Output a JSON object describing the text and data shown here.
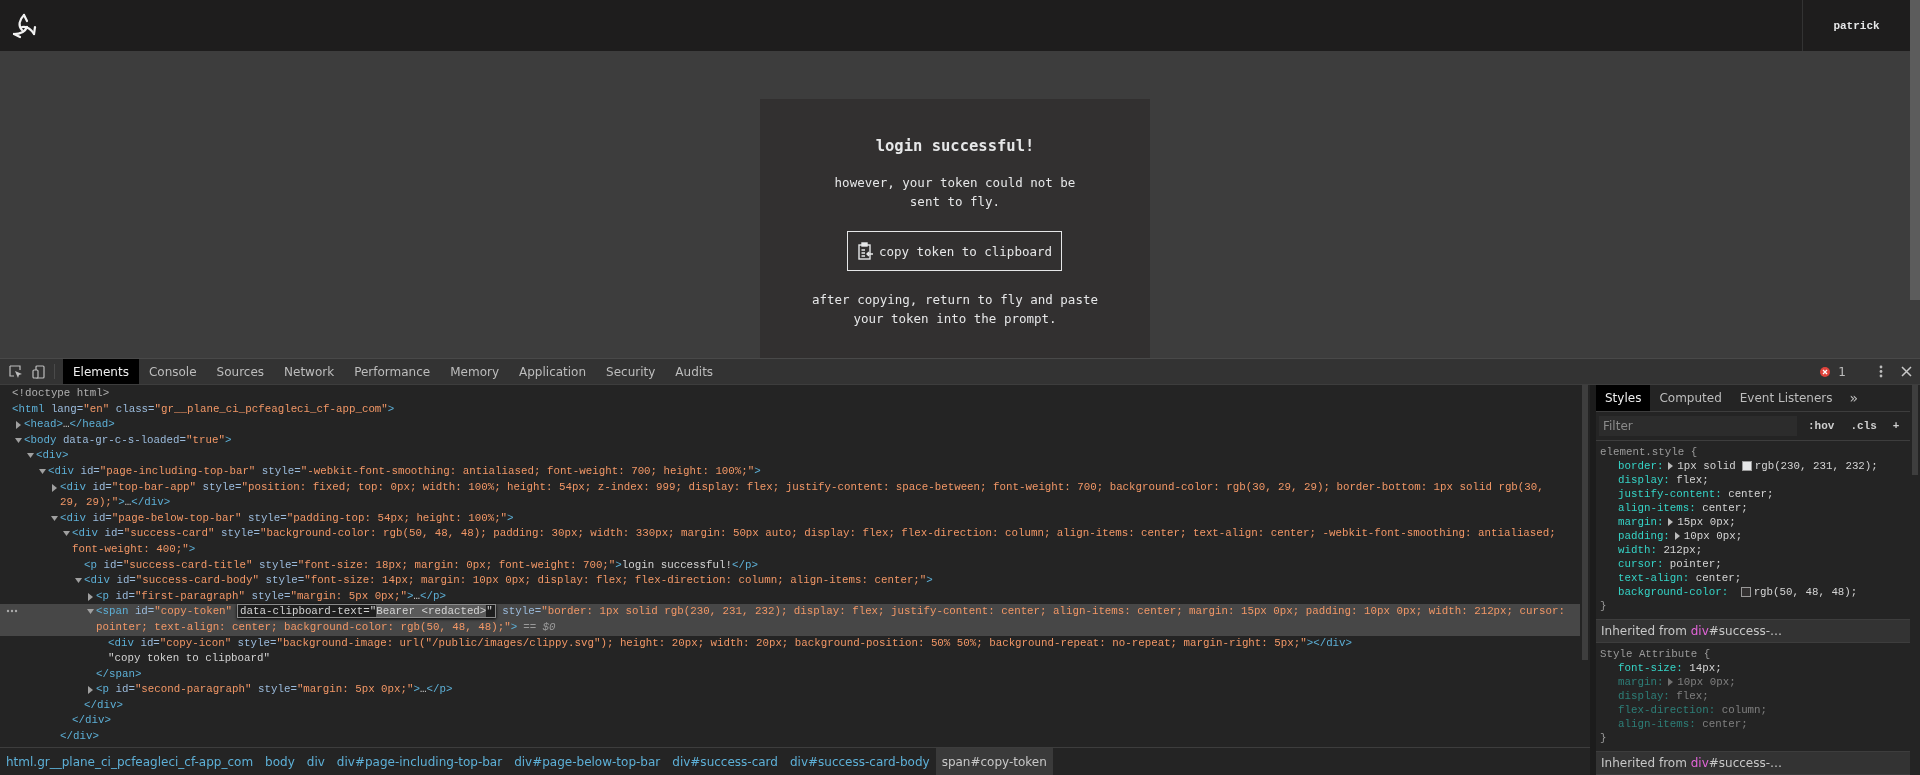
{
  "top_bar": {
    "user": "patrick"
  },
  "card": {
    "title": "login successful!",
    "first_paragraph": "however, your token could not be\nsent to fly.",
    "button": "copy token to clipboard",
    "second_paragraph": "after copying, return to fly and paste\nyour token into the prompt."
  },
  "devtools": {
    "tabs": [
      {
        "label": "Elements",
        "selected": true
      },
      {
        "label": "Console",
        "selected": false
      },
      {
        "label": "Sources",
        "selected": false
      },
      {
        "label": "Network",
        "selected": false
      },
      {
        "label": "Performance",
        "selected": false
      },
      {
        "label": "Memory",
        "selected": false
      },
      {
        "label": "Application",
        "selected": false
      },
      {
        "label": "Security",
        "selected": false
      },
      {
        "label": "Audits",
        "selected": false
      }
    ],
    "errors": "1"
  },
  "tree": [
    {
      "selected": false,
      "parts": [
        {
          "kind": "doctype",
          "text": "<!doctype html>"
        }
      ]
    },
    {
      "selected": false,
      "parts": [
        {
          "kind": "tag",
          "text": "<html"
        },
        {
          "kind": "attr",
          "text": " lang="
        },
        {
          "kind": "value",
          "text": "\"en\""
        },
        {
          "kind": "attr",
          "text": " class="
        },
        {
          "kind": "value",
          "text": "\"gr__plane_ci_pcfeagleci_cf-app_com\""
        },
        {
          "kind": "tag",
          "text": ">"
        }
      ],
      "children": [
        {
          "selected": false,
          "expanded": false,
          "parts": [
            {
              "kind": "tag",
              "text": "<head>"
            },
            {
              "kind": "text",
              "text": "…"
            },
            {
              "kind": "tag",
              "text": "</head>"
            }
          ]
        },
        {
          "selected": false,
          "expanded": true,
          "parts": [
            {
              "kind": "tag",
              "text": "<body"
            },
            {
              "kind": "attr",
              "text": " data-gr-c-s-loaded="
            },
            {
              "kind": "value",
              "text": "\"true\""
            },
            {
              "kind": "tag",
              "text": ">"
            }
          ],
          "children": [
            {
              "selected": false,
              "expanded": true,
              "parts": [
                {
                  "kind": "tag",
                  "text": "<div>"
                }
              ],
              "children": [
                {
                  "selected": false,
                  "expanded": true,
                  "parts": [
                    {
                      "kind": "tag",
                      "text": "<div"
                    },
                    {
                      "kind": "attr",
                      "text": " id="
                    },
                    {
                      "kind": "value",
                      "text": "\"page-including-top-bar\""
                    },
                    {
                      "kind": "attr",
                      "text": " style="
                    },
                    {
                      "kind": "value",
                      "text": "\"-webkit-font-smoothing: antialiased; font-weight: 700; height: 100%;\""
                    },
                    {
                      "kind": "tag",
                      "text": ">"
                    }
                  ],
                  "children": [
                    {
                      "selected": false,
                      "expanded": false,
                      "parts": [
                        {
                          "kind": "tag",
                          "text": "<div"
                        },
                        {
                          "kind": "attr",
                          "text": " id="
                        },
                        {
                          "kind": "value",
                          "text": "\"top-bar-app\""
                        },
                        {
                          "kind": "attr",
                          "text": " style="
                        },
                        {
                          "kind": "value",
                          "text": "\"position: fixed; top: 0px; width: 100%; height: 54px; z-index: 999; display: flex; justify-content: space-between; font-weight: 700; background-color: rgb(30, 29, 29); border-bottom: 1px solid rgb(30, 29, 29);\""
                        },
                        {
                          "kind": "tag",
                          "text": ">"
                        },
                        {
                          "kind": "text",
                          "text": "…"
                        },
                        {
                          "kind": "tag",
                          "text": "</div>"
                        }
                      ]
                    },
                    {
                      "selected": false,
                      "expanded": true,
                      "parts": [
                        {
                          "kind": "tag",
                          "text": "<div"
                        },
                        {
                          "kind": "attr",
                          "text": " id="
                        },
                        {
                          "kind": "value",
                          "text": "\"page-below-top-bar\""
                        },
                        {
                          "kind": "attr",
                          "text": " style="
                        },
                        {
                          "kind": "value",
                          "text": "\"padding-top: 54px; height: 100%;\""
                        },
                        {
                          "kind": "tag",
                          "text": ">"
                        }
                      ],
                      "children": [
                        {
                          "selected": false,
                          "expanded": true,
                          "parts": [
                            {
                              "kind": "tag",
                              "text": "<div"
                            },
                            {
                              "kind": "attr",
                              "text": " id="
                            },
                            {
                              "kind": "value",
                              "text": "\"success-card\""
                            },
                            {
                              "kind": "attr",
                              "text": " style="
                            },
                            {
                              "kind": "value",
                              "text": "\"background-color: rgb(50, 48, 48); padding: 30px; width: 330px; margin: 50px auto; display: flex; flex-direction: column; align-items: center; text-align: center; -webkit-font-smoothing: antialiased; font-weight: 400;\""
                            },
                            {
                              "kind": "tag",
                              "text": ">"
                            }
                          ],
                          "children": [
                            {
                              "selected": false,
                              "parts": [
                                {
                                  "kind": "tag",
                                  "text": "<p"
                                },
                                {
                                  "kind": "attr",
                                  "text": " id="
                                },
                                {
                                  "kind": "value",
                                  "text": "\"success-card-title\""
                                },
                                {
                                  "kind": "attr",
                                  "text": " style="
                                },
                                {
                                  "kind": "value",
                                  "text": "\"font-size: 18px; margin: 0px; font-weight: 700;\""
                                },
                                {
                                  "kind": "tag",
                                  "text": ">"
                                },
                                {
                                  "kind": "text",
                                  "text": "login successful!"
                                },
                                {
                                  "kind": "tag",
                                  "text": "</p>"
                                }
                              ]
                            },
                            {
                              "selected": false,
                              "expanded": true,
                              "parts": [
                                {
                                  "kind": "tag",
                                  "text": "<div"
                                },
                                {
                                  "kind": "attr",
                                  "text": " id="
                                },
                                {
                                  "kind": "value",
                                  "text": "\"success-card-body\""
                                },
                                {
                                  "kind": "attr",
                                  "text": " style="
                                },
                                {
                                  "kind": "value",
                                  "text": "\"font-size: 14px; margin: 10px 0px; display: flex; flex-direction: column; align-items: center;\""
                                },
                                {
                                  "kind": "tag",
                                  "text": ">"
                                }
                              ],
                              "children": [
                                {
                                  "selected": false,
                                  "expanded": false,
                                  "parts": [
                                    {
                                      "kind": "tag",
                                      "text": "<p"
                                    },
                                    {
                                      "kind": "attr",
                                      "text": " id="
                                    },
                                    {
                                      "kind": "value",
                                      "text": "\"first-paragraph\""
                                    },
                                    {
                                      "kind": "attr",
                                      "text": " style="
                                    },
                                    {
                                      "kind": "value",
                                      "text": "\"margin: 5px 0px;\""
                                    },
                                    {
                                      "kind": "tag",
                                      "text": ">"
                                    },
                                    {
                                      "kind": "text",
                                      "text": "…"
                                    },
                                    {
                                      "kind": "tag",
                                      "text": "</p>"
                                    }
                                  ]
                                },
                                {
                                  "selected": true,
                                  "expanded": true,
                                  "parts": [
                                    {
                                      "kind": "tag",
                                      "text": "<span"
                                    },
                                    {
                                      "kind": "attr",
                                      "text": " id="
                                    },
                                    {
                                      "kind": "value",
                                      "text": "\"copy-token\""
                                    },
                                    {
                                      "kind": "edit",
                                      "name": "data-clipboard-text=\"",
                                      "selection": "Bearer <redacted>",
                                      "end": "\""
                                    },
                                    {
                                      "kind": "attr",
                                      "text": " style="
                                    },
                                    {
                                      "kind": "value",
                                      "text": "\"border: 1px solid rgb(230, 231, 232); display: flex; justify-content: center; align-items: center; margin: 15px 0px; padding: 10px 0px; width: 212px; cursor: pointer; text-align: center; background-color: rgb(50, 48, 48);\""
                                    },
                                    {
                                      "kind": "tag",
                                      "text": ">"
                                    },
                                    {
                                      "kind": "marker",
                                      "text": "== $0"
                                    }
                                  ],
                                  "children": [
                                    {
                                      "selected": false,
                                      "parts": [
                                        {
                                          "kind": "tag",
                                          "text": "<div"
                                        },
                                        {
                                          "kind": "attr",
                                          "text": " id="
                                        },
                                        {
                                          "kind": "value",
                                          "text": "\"copy-icon\""
                                        },
                                        {
                                          "kind": "attr",
                                          "text": " style="
                                        },
                                        {
                                          "kind": "value",
                                          "text": "\"background-image: url(\"/public/images/clippy.svg\"); height: 20px; width: 20px; background-position: 50% 50%; background-repeat: no-repeat; margin-right: 5px;\""
                                        },
                                        {
                                          "kind": "tag",
                                          "text": "></div>"
                                        }
                                      ]
                                    },
                                    {
                                      "selected": false,
                                      "parts": [
                                        {
                                          "kind": "text",
                                          "text": "\"copy token to clipboard\""
                                        }
                                      ]
                                    }
                                  ],
                                  "close": [
                                    {
                                      "kind": "tag",
                                      "text": "</span>"
                                    }
                                  ]
                                },
                                {
                                  "selected": false,
                                  "expanded": false,
                                  "parts": [
                                    {
                                      "kind": "tag",
                                      "text": "<p"
                                    },
                                    {
                                      "kind": "attr",
                                      "text": " id="
                                    },
                                    {
                                      "kind": "value",
                                      "text": "\"second-paragraph\""
                                    },
                                    {
                                      "kind": "attr",
                                      "text": " style="
                                    },
                                    {
                                      "kind": "value",
                                      "text": "\"margin: 5px 0px;\""
                                    },
                                    {
                                      "kind": "tag",
                                      "text": ">"
                                    },
                                    {
                                      "kind": "text",
                                      "text": "…"
                                    },
                                    {
                                      "kind": "tag",
                                      "text": "</p>"
                                    }
                                  ]
                                }
                              ],
                              "close": [
                                {
                                  "kind": "tag",
                                  "text": "</div>"
                                }
                              ]
                            }
                          ],
                          "close": [
                            {
                              "kind": "tag",
                              "text": "</div>"
                            }
                          ]
                        }
                      ],
                      "close": [
                        {
                          "kind": "tag",
                          "text": "</div>"
                        }
                      ]
                    }
                  ]
                }
              ]
            }
          ]
        }
      ]
    }
  ],
  "breadcrumbs": [
    {
      "label": "html.gr__plane_ci_pcfeagleci_cf-app_com",
      "selected": false
    },
    {
      "label": "body",
      "selected": false
    },
    {
      "label": "div",
      "selected": false
    },
    {
      "label": "div#page-including-top-bar",
      "selected": false
    },
    {
      "label": "div#page-below-top-bar",
      "selected": false
    },
    {
      "label": "div#success-card",
      "selected": false
    },
    {
      "label": "div#success-card-body",
      "selected": false
    },
    {
      "label": "span#copy-token",
      "selected": true
    }
  ],
  "styles": {
    "tabs": [
      {
        "label": "Styles",
        "selected": true
      },
      {
        "label": "Computed",
        "selected": false
      },
      {
        "label": "Event Listeners",
        "selected": false
      }
    ],
    "more": "»",
    "filter": {
      "placeholder": "Filter"
    },
    "buttons": [
      ":hov",
      ".cls",
      "+"
    ],
    "sections": [
      {
        "kind": "rule",
        "selector": "element.style {",
        "declarations": [
          {
            "property": "border:",
            "expandable": true,
            "inactive": false,
            "value": "1px solid",
            "color": "#e6e7e8",
            "after": "rgb(230, 231, 232);"
          },
          {
            "property": "display:",
            "expandable": false,
            "inactive": false,
            "value": "flex;"
          },
          {
            "property": "justify-content:",
            "expandable": false,
            "inactive": false,
            "value": "center;"
          },
          {
            "property": "align-items:",
            "expandable": false,
            "inactive": false,
            "value": "center;"
          },
          {
            "property": "margin:",
            "expandable": true,
            "inactive": false,
            "value": "15px 0px;"
          },
          {
            "property": "padding:",
            "expandable": true,
            "inactive": false,
            "value": "10px 0px;"
          },
          {
            "property": "width:",
            "expandable": false,
            "inactive": false,
            "value": "212px;"
          },
          {
            "property": "cursor:",
            "expandable": false,
            "inactive": false,
            "value": "pointer;"
          },
          {
            "property": "text-align:",
            "expandable": false,
            "inactive": false,
            "value": "center;"
          },
          {
            "property": "background-color:",
            "expandable": false,
            "inactive": false,
            "color": "#323030",
            "after": "rgb(50, 48, 48);"
          }
        ],
        "close": "}"
      },
      {
        "kind": "inherited",
        "label": "Inherited from",
        "tag": "div",
        "id": "#success-…"
      },
      {
        "kind": "rule",
        "selector": "Style Attribute {",
        "declarations": [
          {
            "property": "font-size:",
            "expandable": false,
            "inactive": false,
            "value": "14px;"
          },
          {
            "property": "margin:",
            "expandable": true,
            "inactive": true,
            "value": "10px 0px;"
          },
          {
            "property": "display:",
            "expandable": false,
            "inactive": true,
            "value": "flex;"
          },
          {
            "property": "flex-direction:",
            "expandable": false,
            "inactive": true,
            "value": "column;"
          },
          {
            "property": "align-items:",
            "expandable": false,
            "inactive": true,
            "value": "center;"
          }
        ],
        "close": "}"
      },
      {
        "kind": "inherited",
        "label": "Inherited from",
        "tag": "div",
        "id": "#success-…"
      }
    ]
  }
}
